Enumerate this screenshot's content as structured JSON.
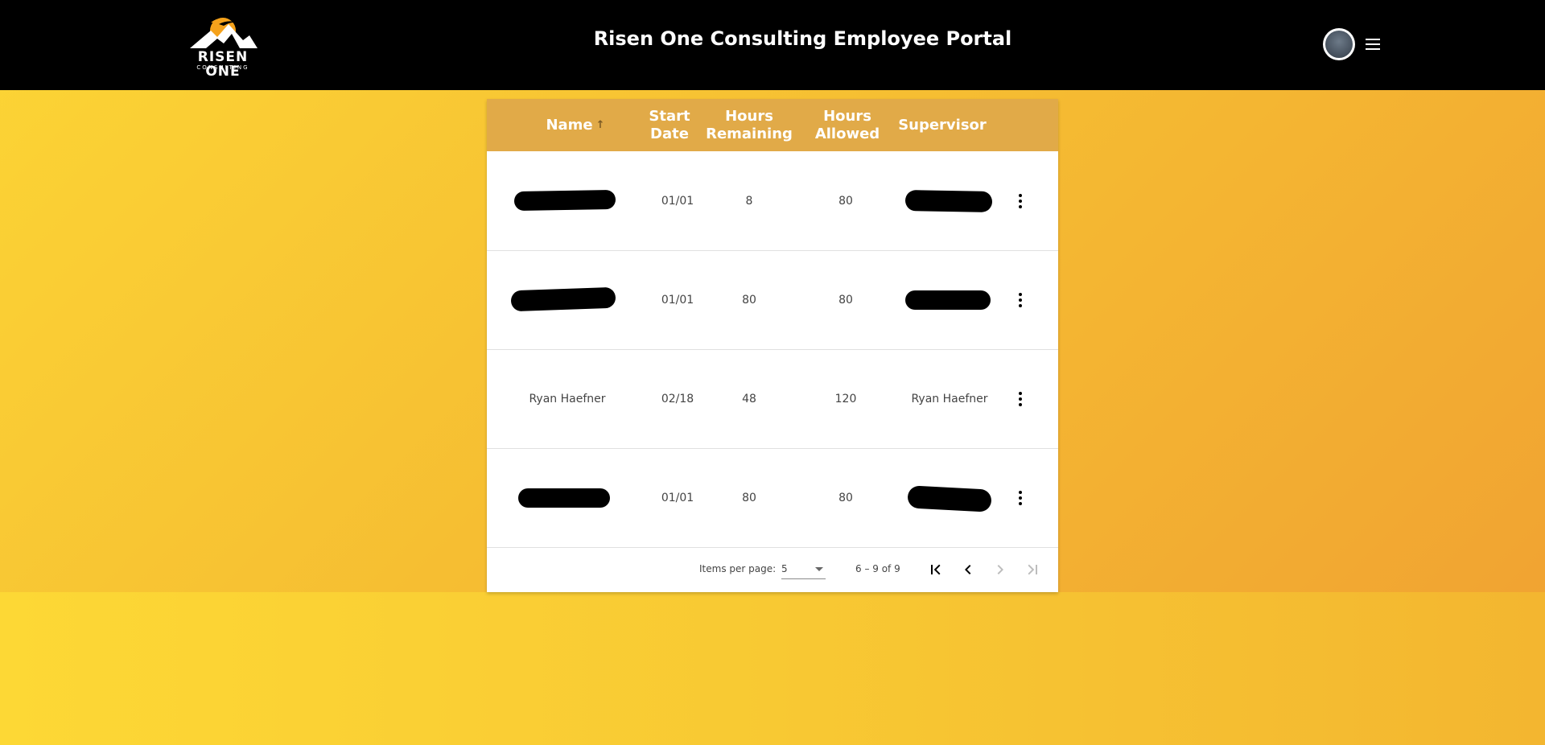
{
  "header": {
    "brand_name": "RISEN ONE",
    "brand_sub": "CONSULTING",
    "title": "Risen One Consulting Employee Portal",
    "avatar_icon": "user-avatar",
    "menu_icon": "hamburger-menu-icon"
  },
  "table": {
    "columns": {
      "name": "Name",
      "sort_indicator": "↑",
      "start_date": "Start Date",
      "hours_remaining": "Hours Remaining",
      "hours_allowed": "Hours Allowed",
      "supervisor": "Supervisor"
    },
    "rows": [
      {
        "name": "",
        "name_redacted": true,
        "start_date": "01/01",
        "hours_remaining": "8",
        "hours_allowed": "80",
        "supervisor": "",
        "supervisor_redacted": true
      },
      {
        "name": "",
        "name_redacted": true,
        "start_date": "01/01",
        "hours_remaining": "80",
        "hours_allowed": "80",
        "supervisor": "",
        "supervisor_redacted": true
      },
      {
        "name": "Ryan Haefner",
        "name_redacted": false,
        "start_date": "02/18",
        "hours_remaining": "48",
        "hours_allowed": "120",
        "supervisor": "Ryan Haefner",
        "supervisor_redacted": false
      },
      {
        "name": "",
        "name_redacted": true,
        "start_date": "01/01",
        "hours_remaining": "80",
        "hours_allowed": "80",
        "supervisor": "",
        "supervisor_redacted": true
      }
    ],
    "row_action_icon": "more-vert-icon"
  },
  "paginator": {
    "items_per_page_label": "Items per page:",
    "items_per_page_value": "5",
    "range_label": "6 – 9 of 9",
    "first_page_enabled": true,
    "prev_page_enabled": true,
    "next_page_enabled": false,
    "last_page_enabled": false
  },
  "colors": {
    "header_bg": "#000000",
    "table_header_bg": "#e1aa48",
    "page_gradient_start": "#fcd535",
    "page_gradient_end": "#f0a032"
  }
}
